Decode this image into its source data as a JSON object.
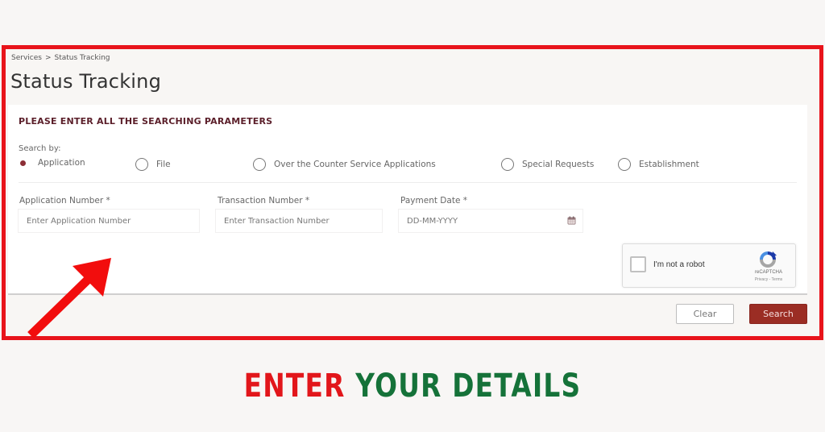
{
  "breadcrumb": {
    "items": [
      "Services",
      "Status Tracking"
    ],
    "separator": ">"
  },
  "page": {
    "title": "Status Tracking"
  },
  "form": {
    "heading": "PLEASE ENTER ALL THE SEARCHING PARAMETERS",
    "search_by_label": "Search by:",
    "search_options": [
      {
        "label": "Application",
        "selected": true
      },
      {
        "label": "File",
        "selected": false
      },
      {
        "label": "Over the Counter Service Applications",
        "selected": false
      },
      {
        "label": "Special Requests",
        "selected": false
      },
      {
        "label": "Establishment",
        "selected": false
      }
    ],
    "fields": [
      {
        "label": "Application Number *",
        "placeholder": "Enter Application Number",
        "value": ""
      },
      {
        "label": "Transaction Number *",
        "placeholder": "Enter Transaction Number",
        "value": ""
      },
      {
        "label": "Payment Date *",
        "placeholder": "DD-MM-YYYY",
        "value": "",
        "icon": "calendar-icon"
      }
    ],
    "captcha": {
      "label": "I'm not a robot",
      "brand": "reCAPTCHA",
      "links": "Privacy - Terms",
      "checked": false
    },
    "buttons": {
      "clear": "Clear",
      "search": "Search"
    }
  },
  "banner": {
    "word1": "ENTER",
    "word2": "YOUR DETAILS"
  },
  "colors": {
    "highlight_frame": "#e8141b",
    "primary_button": "#9b2d24",
    "heading": "#5b1f2a",
    "banner_red": "#e2161b",
    "banner_green": "#157239"
  }
}
